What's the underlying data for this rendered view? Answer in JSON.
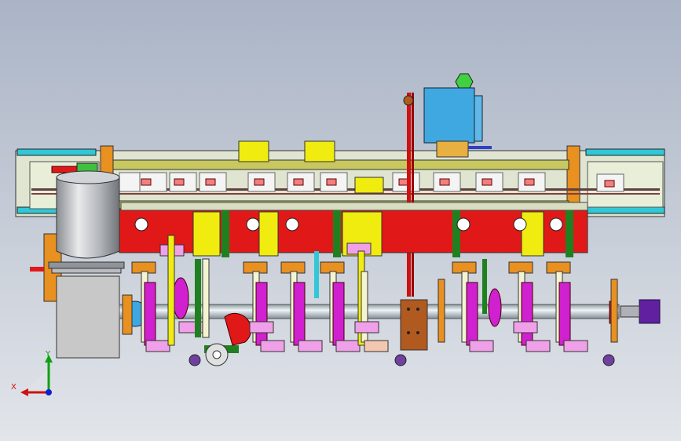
{
  "viewport": {
    "background_top": "#aab4c6",
    "background_bottom": "#e2e5ea"
  },
  "triad": {
    "x_label": "X",
    "y_label": "Y",
    "x_color": "#d01010",
    "y_color": "#10a010",
    "z_color": "#1020d0"
  },
  "colors": {
    "frame_red": "#e01818",
    "frame_yellow": "#f0ec10",
    "rail_olive": "#c8c860",
    "rail_light": "#e8e8b0",
    "cyan_plate": "#30c8d8",
    "orange_block": "#e89020",
    "magenta_arm": "#d020d0",
    "pink_plate": "#f0a0e8",
    "green_rod": "#208020",
    "shaft_steel": "#c8d0d8",
    "motor_blue": "#40a8e0",
    "hopper_steel": "#b8bcc0",
    "gearbox_gray": "#c8c8c8",
    "brown_bracket": "#b05a20",
    "purple_motor": "#6020a0"
  },
  "icons": [
    "hopper-icon",
    "gearbox-icon",
    "motor-icon",
    "cam-icon",
    "triad-icon"
  ]
}
